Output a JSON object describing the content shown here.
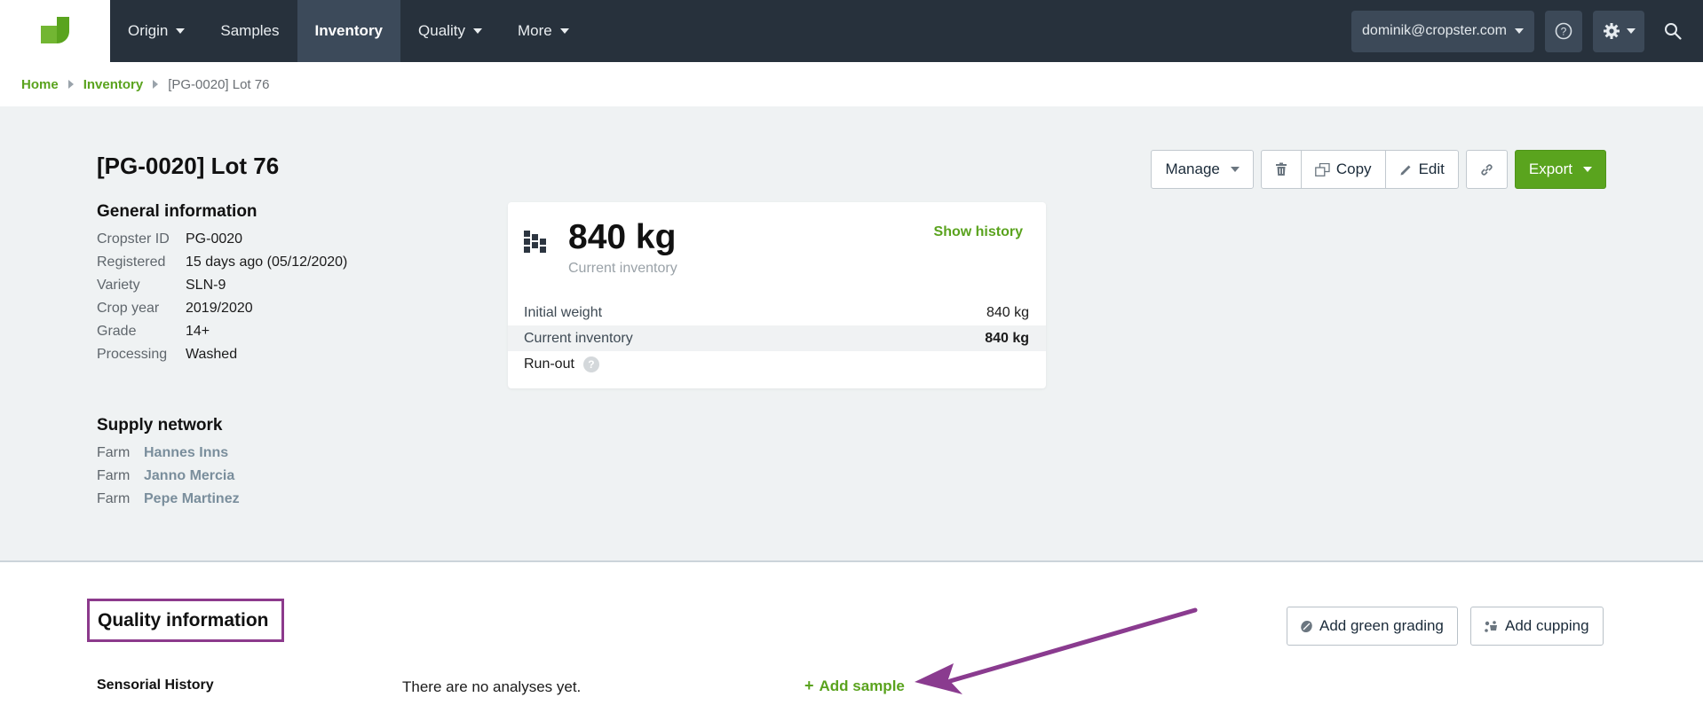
{
  "nav": {
    "items": [
      {
        "label": "Origin",
        "has_caret": true
      },
      {
        "label": "Samples",
        "has_caret": false
      },
      {
        "label": "Inventory",
        "has_caret": false,
        "active": true
      },
      {
        "label": "Quality",
        "has_caret": true
      },
      {
        "label": "More",
        "has_caret": true
      }
    ],
    "user_email": "dominik@cropster.com",
    "icons": [
      "help-icon",
      "gear-icon",
      "search-icon"
    ]
  },
  "breadcrumb": {
    "home": "Home",
    "inventory": "Inventory",
    "current": "[PG-0020] Lot 76"
  },
  "header": {
    "title": "[PG-0020] Lot 76"
  },
  "toolbar": {
    "manage": "Manage",
    "copy": "Copy",
    "edit": "Edit",
    "export": "Export"
  },
  "general": {
    "title": "General information",
    "rows": [
      {
        "label": "Cropster ID",
        "value": "PG-0020"
      },
      {
        "label": "Registered",
        "value": "15 days ago (05/12/2020)"
      },
      {
        "label": "Variety",
        "value": "SLN-9"
      },
      {
        "label": "Crop year",
        "value": "2019/2020"
      },
      {
        "label": "Grade",
        "value": "14+"
      },
      {
        "label": "Processing",
        "value": "Washed"
      }
    ]
  },
  "supply": {
    "title": "Supply network",
    "rows": [
      {
        "label": "Farm",
        "value": "Hannes Inns"
      },
      {
        "label": "Farm",
        "value": "Janno Mercia"
      },
      {
        "label": "Farm",
        "value": "Pepe Martinez"
      }
    ]
  },
  "inventory_card": {
    "big_value": "840 kg",
    "sub_label": "Current inventory",
    "show_history": "Show history",
    "rows": [
      {
        "label": "Initial weight",
        "value": "840 kg"
      },
      {
        "label": "Current inventory",
        "value": "840 kg"
      },
      {
        "label": "Run-out",
        "value": ""
      }
    ],
    "help": "?"
  },
  "quality": {
    "title": "Quality information",
    "add_green_grading": "Add green grading",
    "add_cupping": "Add cupping",
    "sensorial_title": "Sensorial History",
    "no_analyses": "There are no analyses yet.",
    "add_sample": "Add sample",
    "plus": "+"
  },
  "colors": {
    "nav_bg": "#27313c",
    "accent_green": "#5aa31e",
    "highlight_purple": "#8c3a8c"
  }
}
